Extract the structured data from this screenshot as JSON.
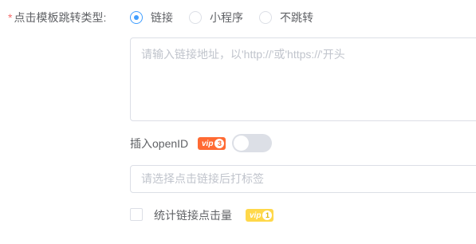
{
  "form": {
    "jump_type": {
      "required_mark": "*",
      "label": "点击模板跳转类型:",
      "options": [
        {
          "label": "链接",
          "checked": true
        },
        {
          "label": "小程序",
          "checked": false
        },
        {
          "label": "不跳转",
          "checked": false
        }
      ]
    },
    "link_input": {
      "placeholder": "请输入链接地址，以'http://'或'https://'开头",
      "value": ""
    },
    "insert_openid": {
      "label": "插入openID",
      "vip": {
        "text": "vip",
        "level": "3",
        "color": "#ff6a33"
      },
      "switch_on": false
    },
    "tag_select": {
      "placeholder": "请选择点击链接后打标签"
    },
    "stat_clicks": {
      "label": "统计链接点击量",
      "checked": false,
      "vip": {
        "text": "vip",
        "level": "1",
        "color": "#ffd84a"
      }
    }
  }
}
